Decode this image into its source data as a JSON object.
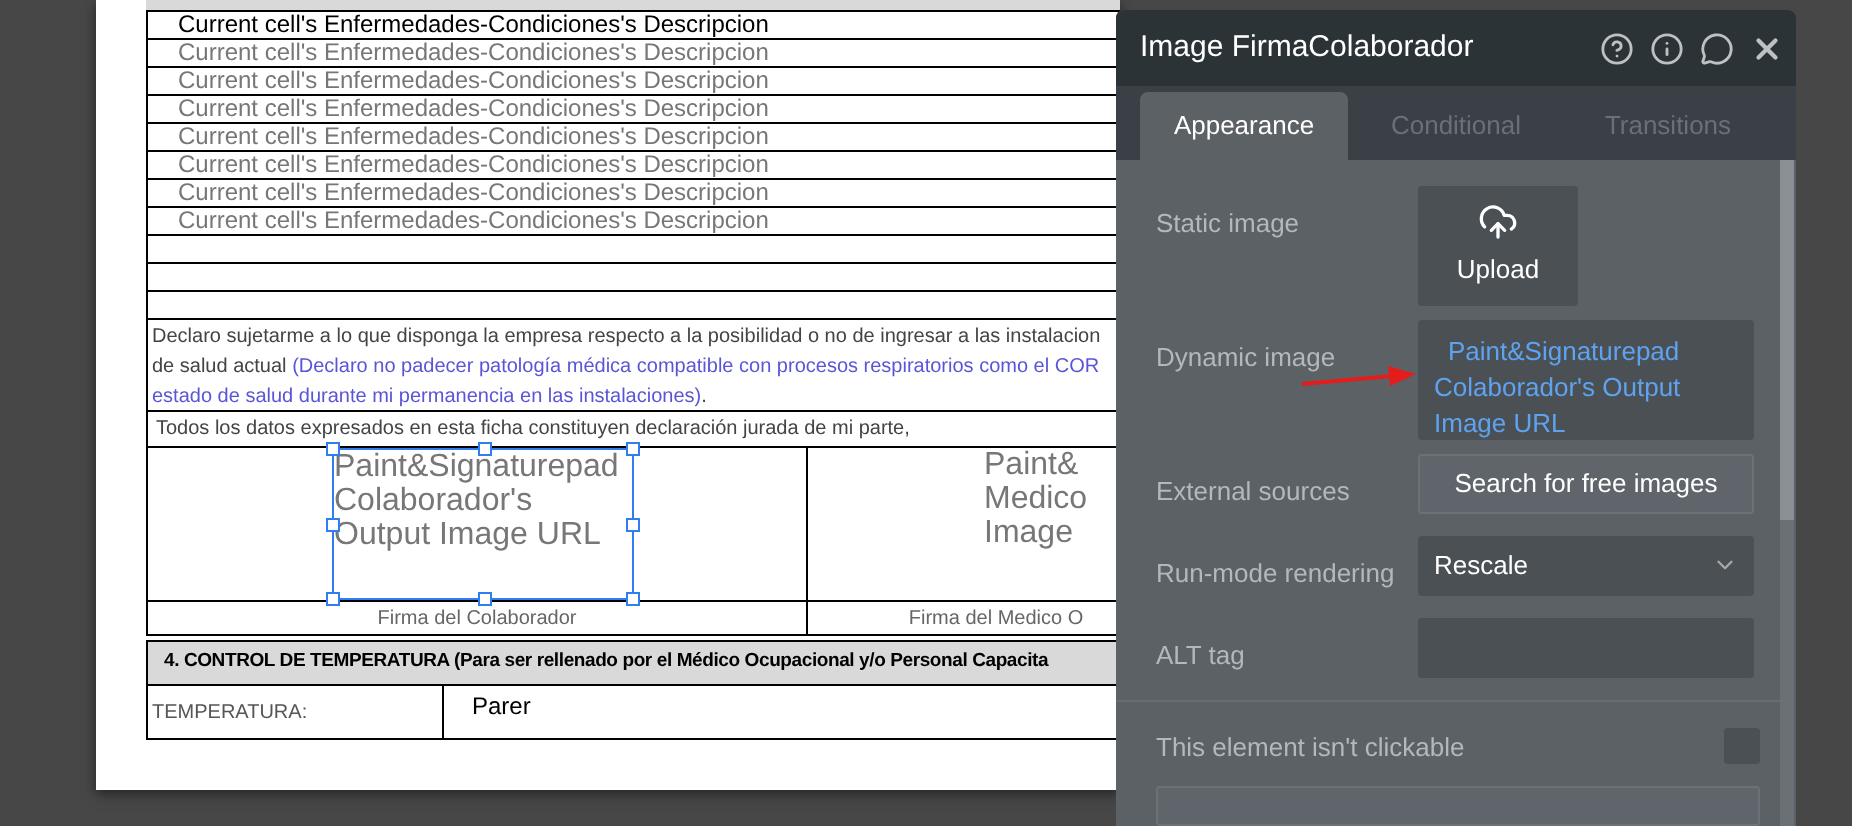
{
  "document": {
    "risk_rows": [
      {
        "text": "Current cell's Enfermedades-Condiciones's Descripcion",
        "selected": true
      },
      {
        "text": "Current cell's Enfermedades-Condiciones's Descripcion",
        "selected": false
      },
      {
        "text": "Current cell's Enfermedades-Condiciones's Descripcion",
        "selected": false
      },
      {
        "text": "Current cell's Enfermedades-Condiciones's Descripcion",
        "selected": false
      },
      {
        "text": "Current cell's Enfermedades-Condiciones's Descripcion",
        "selected": false
      },
      {
        "text": "Current cell's Enfermedades-Condiciones's Descripcion",
        "selected": false
      },
      {
        "text": "Current cell's Enfermedades-Condiciones's Descripcion",
        "selected": false
      },
      {
        "text": "Current cell's Enfermedades-Condiciones's Descripcion",
        "selected": false
      }
    ],
    "declaration": [
      [
        {
          "kind": "plain",
          "text": "Declaro sujetarme a lo que disponga la empresa respecto a la posibilidad o no de ingresar a las instalacion"
        }
      ],
      [
        {
          "kind": "plain",
          "text": "de salud actual "
        },
        {
          "kind": "note",
          "text": "(Declaro no padecer patología médica compatible con procesos respiratorios como el COR"
        }
      ],
      [
        {
          "kind": "note",
          "text": "estado de salud durante mi permanencia en las instalaciones)"
        },
        {
          "kind": "plain",
          "text": "."
        }
      ]
    ],
    "sworn_statement": "Todos los datos  expresados en esta ficha constituyen declaración jurada de mi parte,",
    "signatures": [
      {
        "image_lines": [
          "Paint&Signaturepad",
          "Colaborador's",
          "Output Image URL"
        ],
        "caption": "Firma del Colaborador",
        "selected": true
      },
      {
        "image_lines": [
          "Paint&",
          "Medico",
          "Image"
        ],
        "caption": "Firma del Medico O",
        "selected": false
      }
    ],
    "section_4": {
      "title": "4. CONTROL DE TEMPERATURA (Para ser rellenado por el Médico Ocupacional y/o Personal Capacita",
      "label": "TEMPERATURA:",
      "value": "Parer"
    }
  },
  "panel": {
    "title": "Image FirmaColaborador",
    "tabs": [
      {
        "label": "Appearance",
        "selected": true
      },
      {
        "label": "Conditional",
        "selected": false
      },
      {
        "label": "Transitions",
        "selected": false
      }
    ],
    "properties": [
      {
        "kind": "upload",
        "label": "Static image",
        "value": "Upload"
      },
      {
        "kind": "dynamic",
        "label": "Dynamic image",
        "value": "Paint&Signaturepad Colaborador's Output Image URL"
      },
      {
        "kind": "button",
        "label": "External sources",
        "value": "Search for free images"
      },
      {
        "kind": "dropdown",
        "label": "Run-mode rendering",
        "value": "Rescale"
      },
      {
        "kind": "input",
        "label": "ALT tag"
      }
    ],
    "not_clickable": {
      "label": "This element isn't clickable",
      "checked": false
    }
  }
}
